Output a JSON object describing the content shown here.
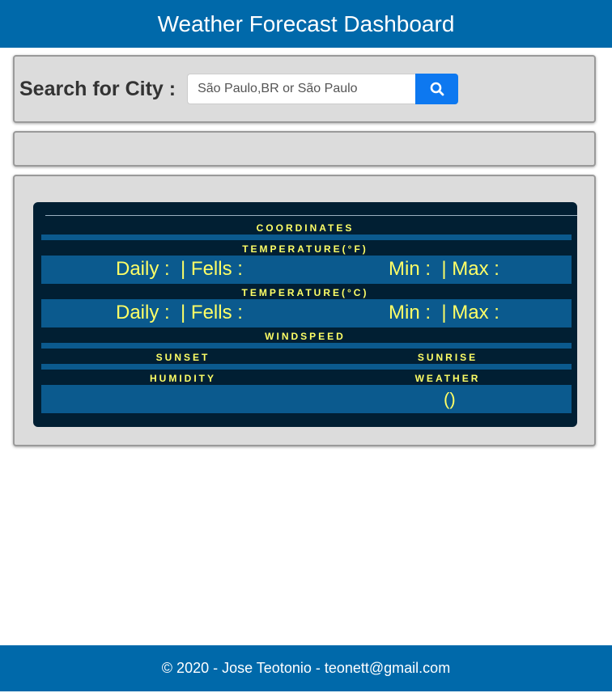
{
  "header": {
    "title": "Weather Forecast Dashboard"
  },
  "search": {
    "label": "Search for City :",
    "placeholder": "São Paulo,BR or São Paulo",
    "button_icon": "search-icon"
  },
  "card": {
    "coordinates_label": "COORDINATES",
    "temp_f_label": "TEMPERATURE(°F)",
    "temp_f_daily": "Daily :  | Fells :",
    "temp_f_minmax": "Min :  | Max :",
    "temp_c_label": "TEMPERATURE(°C)",
    "temp_c_daily": "Daily :  | Fells :",
    "temp_c_minmax": "Min :  | Max :",
    "windspeed_label": "WINDSPEED",
    "sunset_label": "SUNSET",
    "sunrise_label": "SUNRISE",
    "humidity_label": "HUMIDITY",
    "weather_label": "WEATHER",
    "weather_value": "()"
  },
  "footer": {
    "text": "© 2020 - Jose Teotonio - teonett@gmail.com"
  },
  "colors": {
    "brand": "#0069aa",
    "accent": "#0d78f0",
    "card_bg": "#011f33",
    "card_bar": "#0b5a8e",
    "highlight": "#ffff66"
  }
}
